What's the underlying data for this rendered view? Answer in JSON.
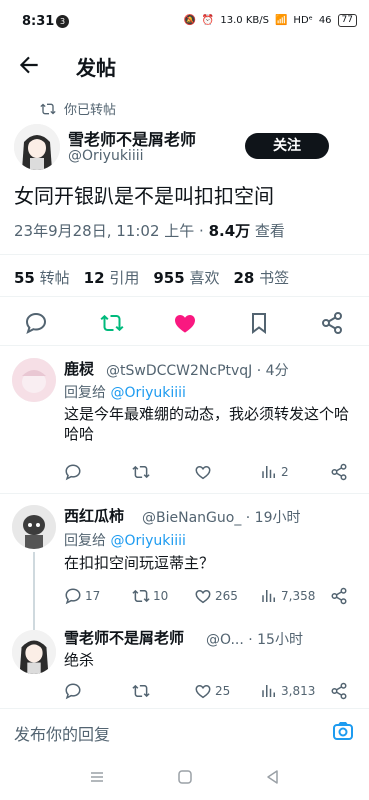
{
  "status": {
    "time": "8:31",
    "notif": "3",
    "net": "13.0 KB/S",
    "hd": "HDᵉ",
    "signal": "46",
    "battery": "77"
  },
  "header": {
    "title": "发帖"
  },
  "tweet": {
    "retweeted_label": "你已转帖",
    "author_name": "雪老师不是屑老师",
    "author_handle": "@Oriyukiiii",
    "follow_label": "关注",
    "text": "女同开银趴是不是叫扣扣空间",
    "timestamp": "23年9月28日, 11:02 上午 · ",
    "views_count": "8.4万",
    "views_word": " 查看",
    "stats": [
      {
        "count": "55",
        "label": "转帖"
      },
      {
        "count": "12",
        "label": "引用"
      },
      {
        "count": "955",
        "label": "喜欢"
      },
      {
        "count": "28",
        "label": "书签"
      }
    ]
  },
  "replies": [
    {
      "name": "鹿棂",
      "handle": "@tSwDCCW2NcPtvqJ · 4分",
      "reply_to_prefix": "回复给 ",
      "reply_to_handle": "@Oriyukiiii",
      "text": "这是今年最难绷的动态，我必须转发这个哈哈哈",
      "reply_count": "",
      "retweet_count": "",
      "like_count": "",
      "view_count": "2"
    },
    {
      "name": "西红瓜柿",
      "handle": "@BieNanGuo_ · 19小时",
      "reply_to_prefix": "回复给 ",
      "reply_to_handle": "@Oriyukiiii",
      "text": "在扣扣空间玩逗蒂主？",
      "reply_count": "17",
      "retweet_count": "10",
      "like_count": "265",
      "view_count": "7,358"
    },
    {
      "name": "雪老师不是屑老师",
      "handle": "@O... · 15小时",
      "text": "绝杀",
      "reply_count": "",
      "retweet_count": "",
      "like_count": "25",
      "view_count": "3,813"
    }
  ],
  "compose": {
    "placeholder": "发布你的回复"
  },
  "colors": {
    "accent": "#1d9bf0",
    "retweet_green": "#00ba7c",
    "like_pink": "#f91880",
    "text": "#0f1419",
    "muted": "#536471"
  }
}
